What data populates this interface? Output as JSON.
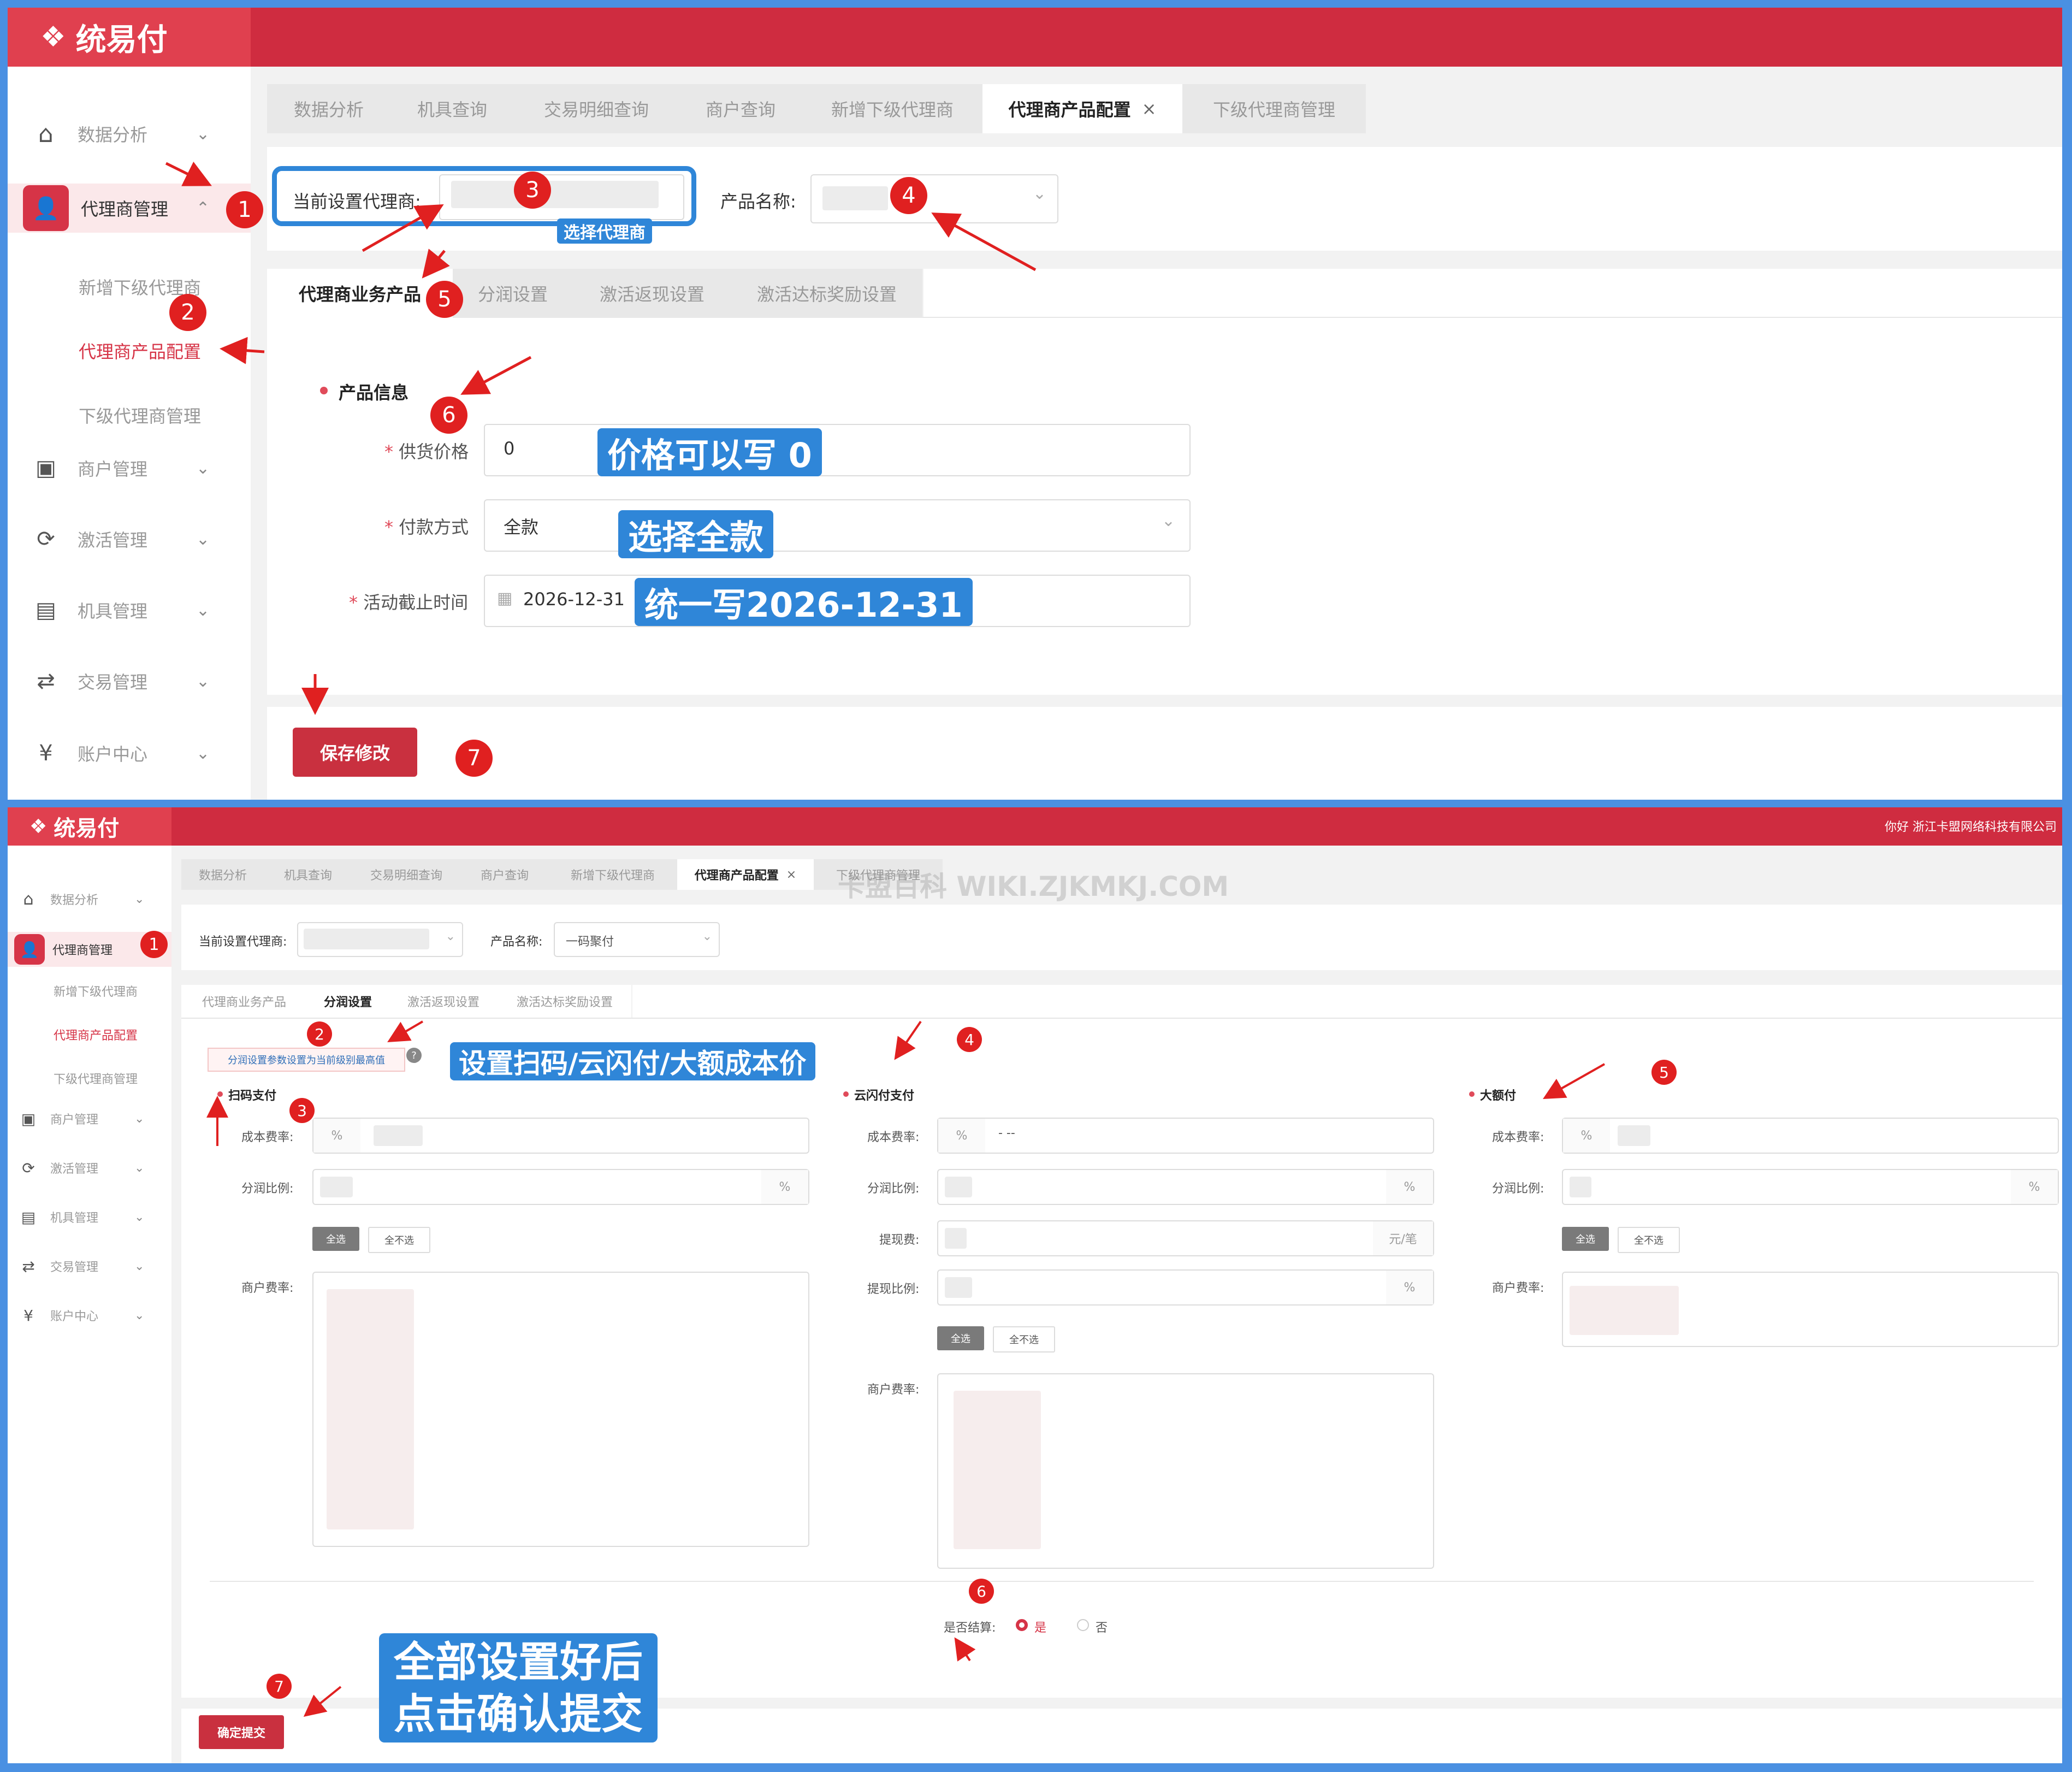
{
  "brand": {
    "logo": "统易付"
  },
  "greeting": "你好 浙江卡盟网络科技有限公司",
  "watermark": "卡盟百科  WIKI.ZJKMKJ.COM",
  "sidebar": {
    "items": [
      {
        "label": "数据分析",
        "icon": "home-icon"
      },
      {
        "label": "代理商管理",
        "icon": "user-icon"
      },
      {
        "label": "商户管理",
        "icon": "shop-icon"
      },
      {
        "label": "激活管理",
        "icon": "activate-icon"
      },
      {
        "label": "机具管理",
        "icon": "device-icon"
      },
      {
        "label": "交易管理",
        "icon": "exchange-icon"
      },
      {
        "label": "账户中心",
        "icon": "yen-icon"
      }
    ],
    "sub_items": [
      "新增下级代理商",
      "代理商产品配置",
      "下级代理商管理"
    ]
  },
  "top_tabs": [
    {
      "label": "数据分析"
    },
    {
      "label": "机具查询"
    },
    {
      "label": "交易明细查询"
    },
    {
      "label": "商户查询"
    },
    {
      "label": "新增下级代理商"
    },
    {
      "label": "代理商产品配置",
      "close": "×"
    },
    {
      "label": "下级代理商管理"
    }
  ],
  "filter": {
    "agent_label": "当前设置代理商:",
    "product_label": "产品名称:",
    "product_value_2": "一码聚付"
  },
  "sub_tabs": [
    "代理商业务产品",
    "分润设置",
    "激活返现设置",
    "激活达标奖励设置"
  ],
  "panel1": {
    "section_title": "产品信息",
    "fields": [
      {
        "label": "供货价格",
        "value": "0"
      },
      {
        "label": "付款方式",
        "value": "全款"
      },
      {
        "label": "活动截止时间",
        "value": "2026-12-31"
      }
    ],
    "save_button": "保存修改",
    "annotations": {
      "select_agent": "选择代理商",
      "price": "价格可以写 0",
      "payment": "选择全款",
      "date": "统一写2026-12-31"
    },
    "badges": [
      "1",
      "2",
      "3",
      "4",
      "5",
      "6",
      "7"
    ]
  },
  "panel2": {
    "notice": "分润设置参数设置为当前级别最高值",
    "help": "?",
    "columns": [
      {
        "title": "扫码支付"
      },
      {
        "title": "云闪付支付"
      },
      {
        "title": "大额付"
      }
    ],
    "labels": {
      "cost_rate": "成本费率:",
      "share_ratio": "分润比例:",
      "withdraw_fee": "提现费:",
      "withdraw_ratio": "提现比例:",
      "merchant_rate": "商户费率:",
      "percent": "%",
      "yuan_per": "元/笔",
      "cost_dash": "- --",
      "select_all": "全选",
      "select_none": "全不选"
    },
    "settle": {
      "label": "是否结算:",
      "yes": "是",
      "no": "否",
      "selected": "是"
    },
    "submit_button": "确定提交",
    "annotations": {
      "set_cost": "设置扫码/云闪付/大额成本价",
      "final_1": "全部设置好后",
      "final_2": "点击确认提交"
    },
    "badges": [
      "1",
      "2",
      "3",
      "4",
      "5",
      "6",
      "7"
    ]
  },
  "colors": {
    "brand_red": "#cf2c40",
    "annotation_blue": "#2f86d8",
    "badge_red": "#e02020",
    "frame_blue": "#4a90e2"
  }
}
